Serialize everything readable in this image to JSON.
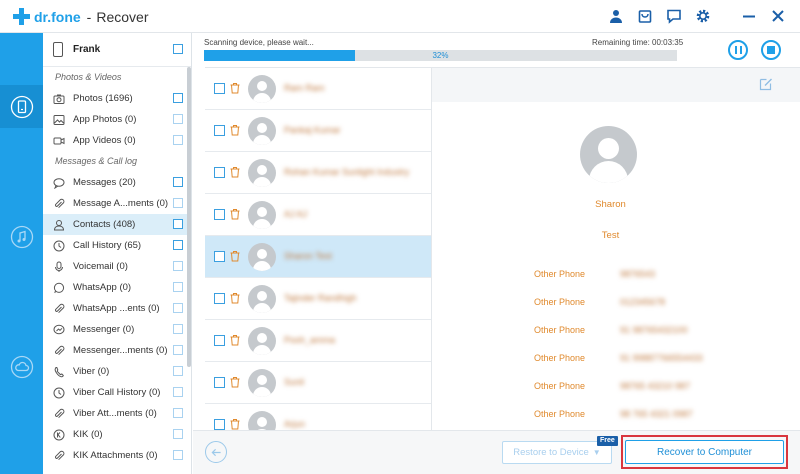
{
  "app": {
    "brand": "dr.fone",
    "separator": "-",
    "title": "Recover"
  },
  "titlebar_icons": [
    "user-icon",
    "cart-icon",
    "feedback-icon",
    "settings-icon",
    "minimize-icon",
    "close-icon"
  ],
  "rail": [
    "phone-recover-icon",
    "music-icon",
    "cloud-icon"
  ],
  "device": {
    "name": "Frank"
  },
  "sections": {
    "photos": "Photos & Videos",
    "messages": "Messages & Call log"
  },
  "categories": [
    {
      "label": "Photos (1696)",
      "icon": "photo-icon"
    },
    {
      "label": "App Photos (0)",
      "icon": "app-photo-icon"
    },
    {
      "label": "App Videos (0)",
      "icon": "video-icon"
    },
    {
      "label": "Messages (20)",
      "icon": "message-icon"
    },
    {
      "label": "Message A...ments (0)",
      "icon": "attachment-icon"
    },
    {
      "label": "Contacts (408)",
      "icon": "contact-icon"
    },
    {
      "label": "Call History (65)",
      "icon": "clock-icon"
    },
    {
      "label": "Voicemail (0)",
      "icon": "mic-icon"
    },
    {
      "label": "WhatsApp (0)",
      "icon": "whatsapp-icon"
    },
    {
      "label": "WhatsApp ...ents (0)",
      "icon": "attachment-icon"
    },
    {
      "label": "Messenger (0)",
      "icon": "messenger-icon"
    },
    {
      "label": "Messenger...ments (0)",
      "icon": "attachment-icon"
    },
    {
      "label": "Viber (0)",
      "icon": "viber-icon"
    },
    {
      "label": "Viber Call History (0)",
      "icon": "clock-icon"
    },
    {
      "label": "Viber Att...ments (0)",
      "icon": "attachment-icon"
    },
    {
      "label": "KIK (0)",
      "icon": "kik-icon"
    },
    {
      "label": "KIK Attachments (0)",
      "icon": "attachment-icon"
    }
  ],
  "scan": {
    "status": "Scanning device, please wait...",
    "remaining": "Remaining time: 00:03:35",
    "percent_label": "32%",
    "percent": 32
  },
  "contacts": [
    {
      "name": "Ram Ram"
    },
    {
      "name": "Pankaj Kumar"
    },
    {
      "name": "Rohan Kumar Sunlight Industry"
    },
    {
      "name": "AJ AJ"
    },
    {
      "name": "Sharon Test"
    },
    {
      "name": "Tajinder Randhigh"
    },
    {
      "name": "Pooh_amma"
    },
    {
      "name": "Sunil"
    },
    {
      "name": "Arjun"
    }
  ],
  "detail": {
    "name": "Sharon",
    "second": "Test",
    "fields": [
      {
        "label": "Other Phone",
        "value": "9876543"
      },
      {
        "label": "Other Phone",
        "value": "012345678"
      },
      {
        "label": "Other Phone",
        "value": "91 98765432100"
      },
      {
        "label": "Other Phone",
        "value": "91 99887766554433"
      },
      {
        "label": "Other Phone",
        "value": "98765 43210 987"
      },
      {
        "label": "Other Phone",
        "value": "98 765 4321 0987"
      }
    ]
  },
  "footer": {
    "restore": "Restore to Device",
    "free": "Free",
    "recover": "Recover to Computer"
  },
  "colors": {
    "accent": "#1fa0e8",
    "highlight": "#d9363e",
    "orange": "#e08a2e"
  }
}
